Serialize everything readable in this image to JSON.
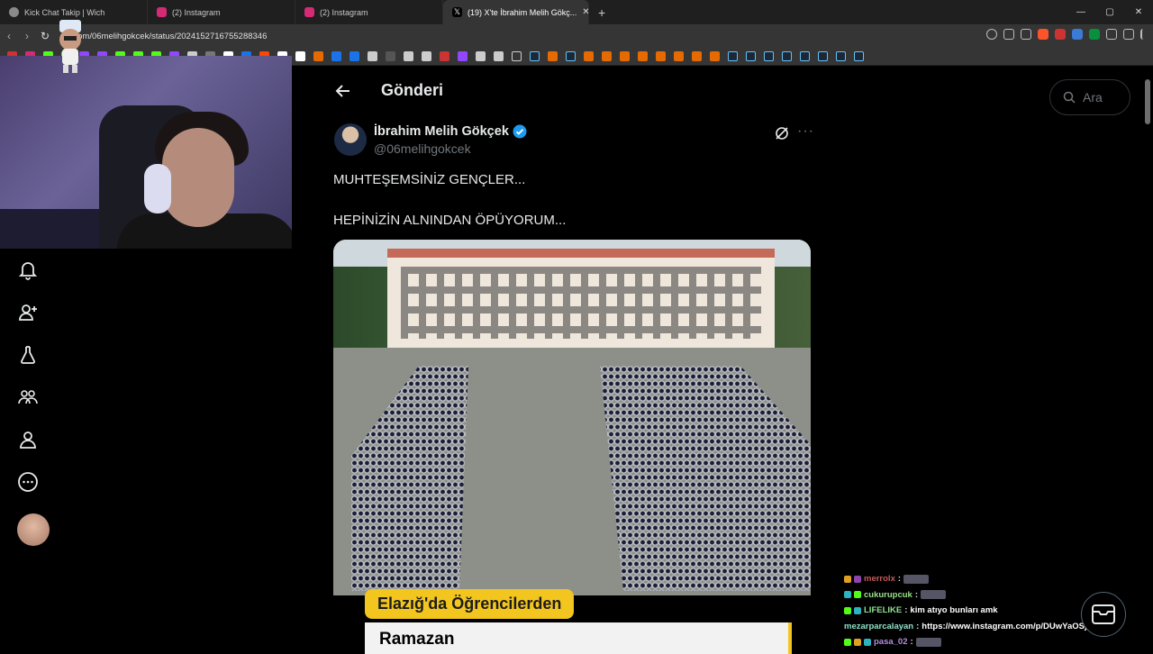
{
  "browser": {
    "tabs": [
      {
        "title": "Kick Chat Takip | Wich",
        "color": "#8a8a8a"
      },
      {
        "title": "(2) Instagram",
        "color": "#d62976"
      },
      {
        "title": "(2) Instagram",
        "color": "#d62976"
      },
      {
        "title": "(19) X'te İbrahim Melih Gökç...",
        "color": "#ffffff",
        "active": true
      }
    ],
    "url": "x.com/06melihgokcek/status/2024152716755288346",
    "window_controls": [
      "—",
      "▢",
      "✕"
    ]
  },
  "x": {
    "page_title": "Gönderi",
    "search_placeholder": "Ara",
    "author": {
      "name": "İbrahim Melih Gökçek",
      "handle": "@06melihgokcek",
      "verified": true
    },
    "tweet": {
      "line1": "MUHTEŞEMSİNİZ GENÇLER...",
      "line2": "HEPİNİZİN ALNINDAN ÖPÜYORUM..."
    },
    "media": {
      "caption1": "Elazığ'da Öğrencilerden",
      "caption2": "Ramazan"
    },
    "sidebar_icons": [
      "bell-icon",
      "add-user-icon",
      "flask-icon",
      "communities-icon",
      "profile-icon",
      "more-circle-icon"
    ]
  },
  "chat": [
    {
      "user": "merrolx",
      "color": "#c75b5b",
      "text": ""
    },
    {
      "user": "cukurupcuk",
      "color": "#9be08a",
      "text": ""
    },
    {
      "user": "LIFELIKE",
      "color": "#8ee28e",
      "text": "kim atıyo bunları amk"
    },
    {
      "user": "mezarparcalayan",
      "color": "#8ee2c8",
      "text": "https://www.instagram.com/p/DUwYaOSjkV4/"
    },
    {
      "user": "pasa_02",
      "color": "#b48ee2",
      "text": ""
    }
  ]
}
